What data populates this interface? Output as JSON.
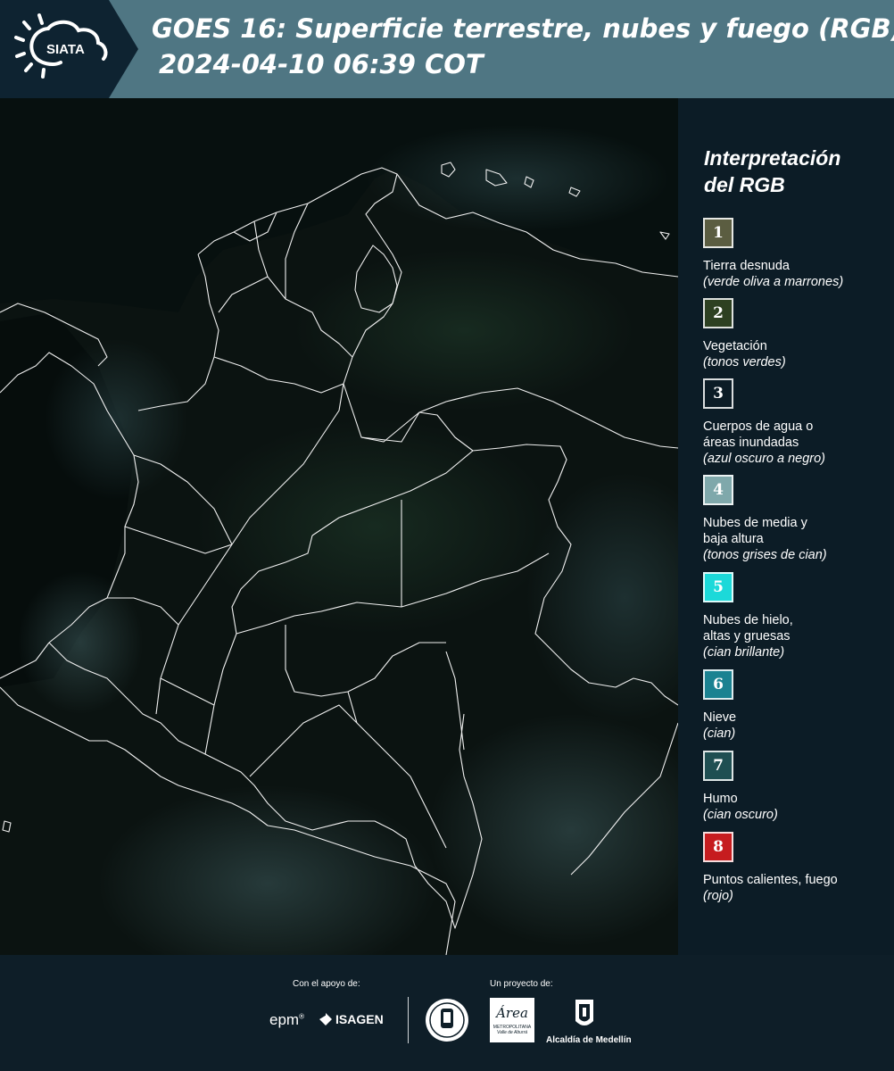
{
  "header": {
    "logo_text": "SIATA",
    "title": "GOES 16: Superficie terrestre, nubes y fuego (RGB)",
    "subtitle": "2024-04-10 06:39 COT"
  },
  "map": {
    "background_color": "#0b1311",
    "border_color": "#f0f0f0"
  },
  "legend": {
    "title_line1": "Interpretación",
    "title_line2": "del RGB",
    "items": [
      {
        "number": "1",
        "label": "Tierra desnuda",
        "note": "(verde oliva a marrones)",
        "color": "#5b5d41"
      },
      {
        "number": "2",
        "label": "Vegetación",
        "note": "(tonos verdes)",
        "color": "#2d4021"
      },
      {
        "number": "3",
        "label": "Cuerpos de agua o\náreas inundadas",
        "note": "(azul oscuro a negro)",
        "color": "#0c1c26"
      },
      {
        "number": "4",
        "label": "Nubes de media y\nbaja altura",
        "note": "(tonos grises de cian)",
        "color": "#7fa8ab"
      },
      {
        "number": "5",
        "label": "Nubes de hielo,\naltas y gruesas",
        "note": "(cian brillante)",
        "color": "#1cd9d9"
      },
      {
        "number": "6",
        "label": "Nieve",
        "note": "(cian)",
        "color": "#1b8291"
      },
      {
        "number": "7",
        "label": "Humo",
        "note": "(cian oscuro)",
        "color": "#1f4f52"
      },
      {
        "number": "8",
        "label": "Puntos calientes, fuego",
        "note": "(rojo)",
        "color": "#c61c1f"
      }
    ]
  },
  "footer": {
    "support_caption": "Con el apoyo de:",
    "project_caption": "Un proyecto de:",
    "epm": "epm",
    "isagen": "ISAGEN",
    "area_logo": "Área",
    "area_sub1": "METROPOLITANA",
    "area_sub2": "Valle de Aburrá",
    "alcaldia": "Alcaldía de Medellín"
  }
}
